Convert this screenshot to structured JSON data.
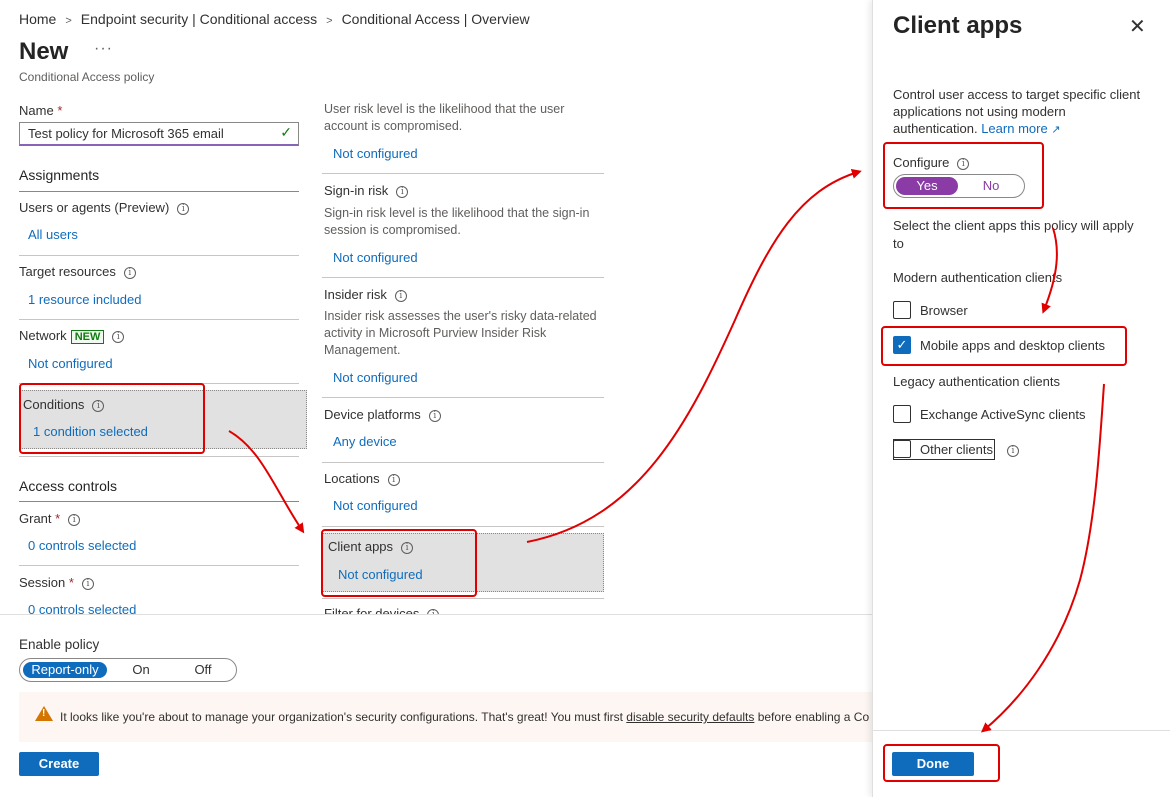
{
  "breadcrumb": [
    "Home",
    "Endpoint security | Conditional access",
    "Conditional Access | Overview"
  ],
  "page": {
    "title": "New",
    "more": "···",
    "subtitle": "Conditional Access policy"
  },
  "name_field": {
    "label": "Name",
    "required": "*",
    "value": "Test policy for Microsoft 365 email"
  },
  "assignments": {
    "heading": "Assignments",
    "users": {
      "label": "Users or agents (Preview)",
      "value": "All users"
    },
    "target": {
      "label": "Target resources",
      "value": "1 resource included"
    },
    "network": {
      "label": "Network",
      "badge": "NEW",
      "value": "Not configured"
    },
    "conditions": {
      "label": "Conditions",
      "value": "1 condition selected"
    }
  },
  "access_controls": {
    "heading": "Access controls",
    "grant": {
      "label": "Grant",
      "required": "*",
      "value": "0 controls selected"
    },
    "session": {
      "label": "Session",
      "required": "*",
      "value": "0 controls selected"
    }
  },
  "conditions_list": {
    "user_risk": {
      "desc": "User risk level is the likelihood that the user account is compromised.",
      "value": "Not configured"
    },
    "signin_risk": {
      "label": "Sign-in risk",
      "desc": "Sign-in risk level is the likelihood that the sign-in session is compromised.",
      "value": "Not configured"
    },
    "insider_risk": {
      "label": "Insider risk",
      "desc": "Insider risk assesses the user's risky data-related activity in Microsoft Purview Insider Risk Management.",
      "value": "Not configured"
    },
    "device_platforms": {
      "label": "Device platforms",
      "value": "Any device"
    },
    "locations": {
      "label": "Locations",
      "value": "Not configured"
    },
    "client_apps": {
      "label": "Client apps",
      "value": "Not configured"
    },
    "filter_devices": {
      "label": "Filter for devices"
    }
  },
  "enable_policy": {
    "label": "Enable policy",
    "options": [
      "Report-only",
      "On",
      "Off"
    ],
    "selected": "Report-only"
  },
  "warning": {
    "text": "It looks like you're about to manage your organization's security configurations. That's great! You must first ",
    "link": "disable security defaults",
    "text_after": " before enabling a Co"
  },
  "create_button": "Create",
  "panel": {
    "title": "Client apps",
    "close": "✕",
    "desc": "Control user access to target specific client applications not using modern authentication.",
    "learn_more": "Learn more",
    "configure": {
      "label": "Configure",
      "options": [
        "Yes",
        "No"
      ],
      "selected": "Yes"
    },
    "select_text": "Select the client apps this policy will apply to",
    "modern_heading": "Modern authentication clients",
    "browser": {
      "label": "Browser",
      "checked": false
    },
    "mobile": {
      "label": "Mobile apps and desktop clients",
      "checked": true
    },
    "legacy_heading": "Legacy authentication clients",
    "exchange": {
      "label": "Exchange ActiveSync clients",
      "checked": false
    },
    "other": {
      "label": "Other clients",
      "checked": false
    },
    "done": "Done"
  },
  "colors": {
    "accent": "#0f6cbd",
    "annotation_red": "#e00000",
    "toggle_purple": "#8a3ba6"
  }
}
